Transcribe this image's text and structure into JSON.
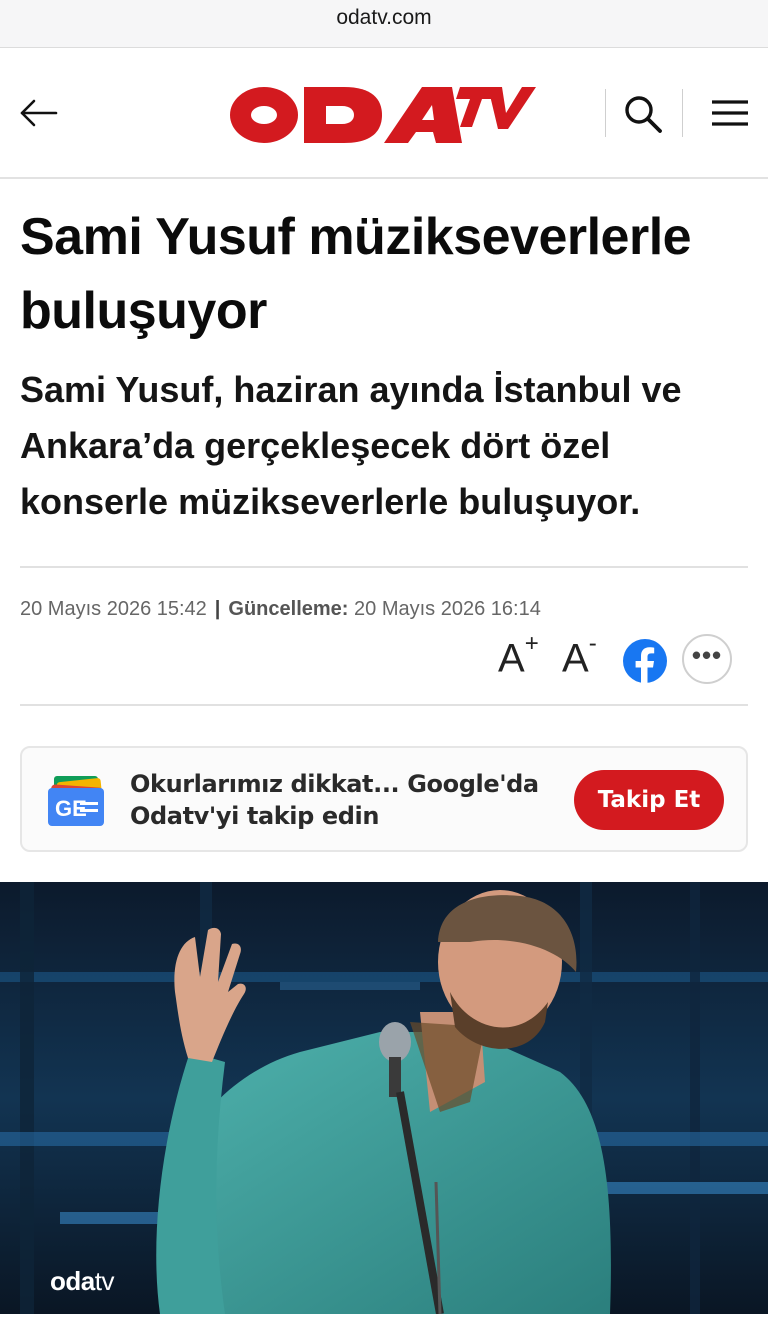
{
  "browser": {
    "url": "odatv.com"
  },
  "header": {
    "logo_text": "ODATV",
    "back_label": "back",
    "search_label": "search",
    "menu_label": "menu"
  },
  "article": {
    "title": "Sami Yusuf müzikseverlerle buluşuyor",
    "spot": "Sami Yusuf, haziran ayında İstanbul ve Ankara’da gerçekleşecek dört özel konserle müzikseverlerle buluşuyor.",
    "published": "20 Mayıs 2026 15:42",
    "separator": "|",
    "updated_label": "Güncelleme:",
    "updated": "20 Mayıs 2026 16:14"
  },
  "tools": {
    "font_increase": "A",
    "font_increase_sup": "+",
    "font_decrease": "A",
    "font_decrease_sup": "-",
    "share_icon": "facebook-icon",
    "more_icon": "more-icon",
    "more_label": "•••"
  },
  "google_card": {
    "text": "Okurlarımız dikkat... Google'da Odatv'yi takip edin",
    "button_label": "Takip Et",
    "icon": "google-news-icon"
  },
  "hero": {
    "watermark_main": "oda",
    "watermark_tv": "tv"
  },
  "colors": {
    "brand_red": "#d31a1f",
    "facebook_blue": "#1877f2",
    "stage_blue": "#0a1726",
    "shirt_teal": "#3a9a97"
  }
}
